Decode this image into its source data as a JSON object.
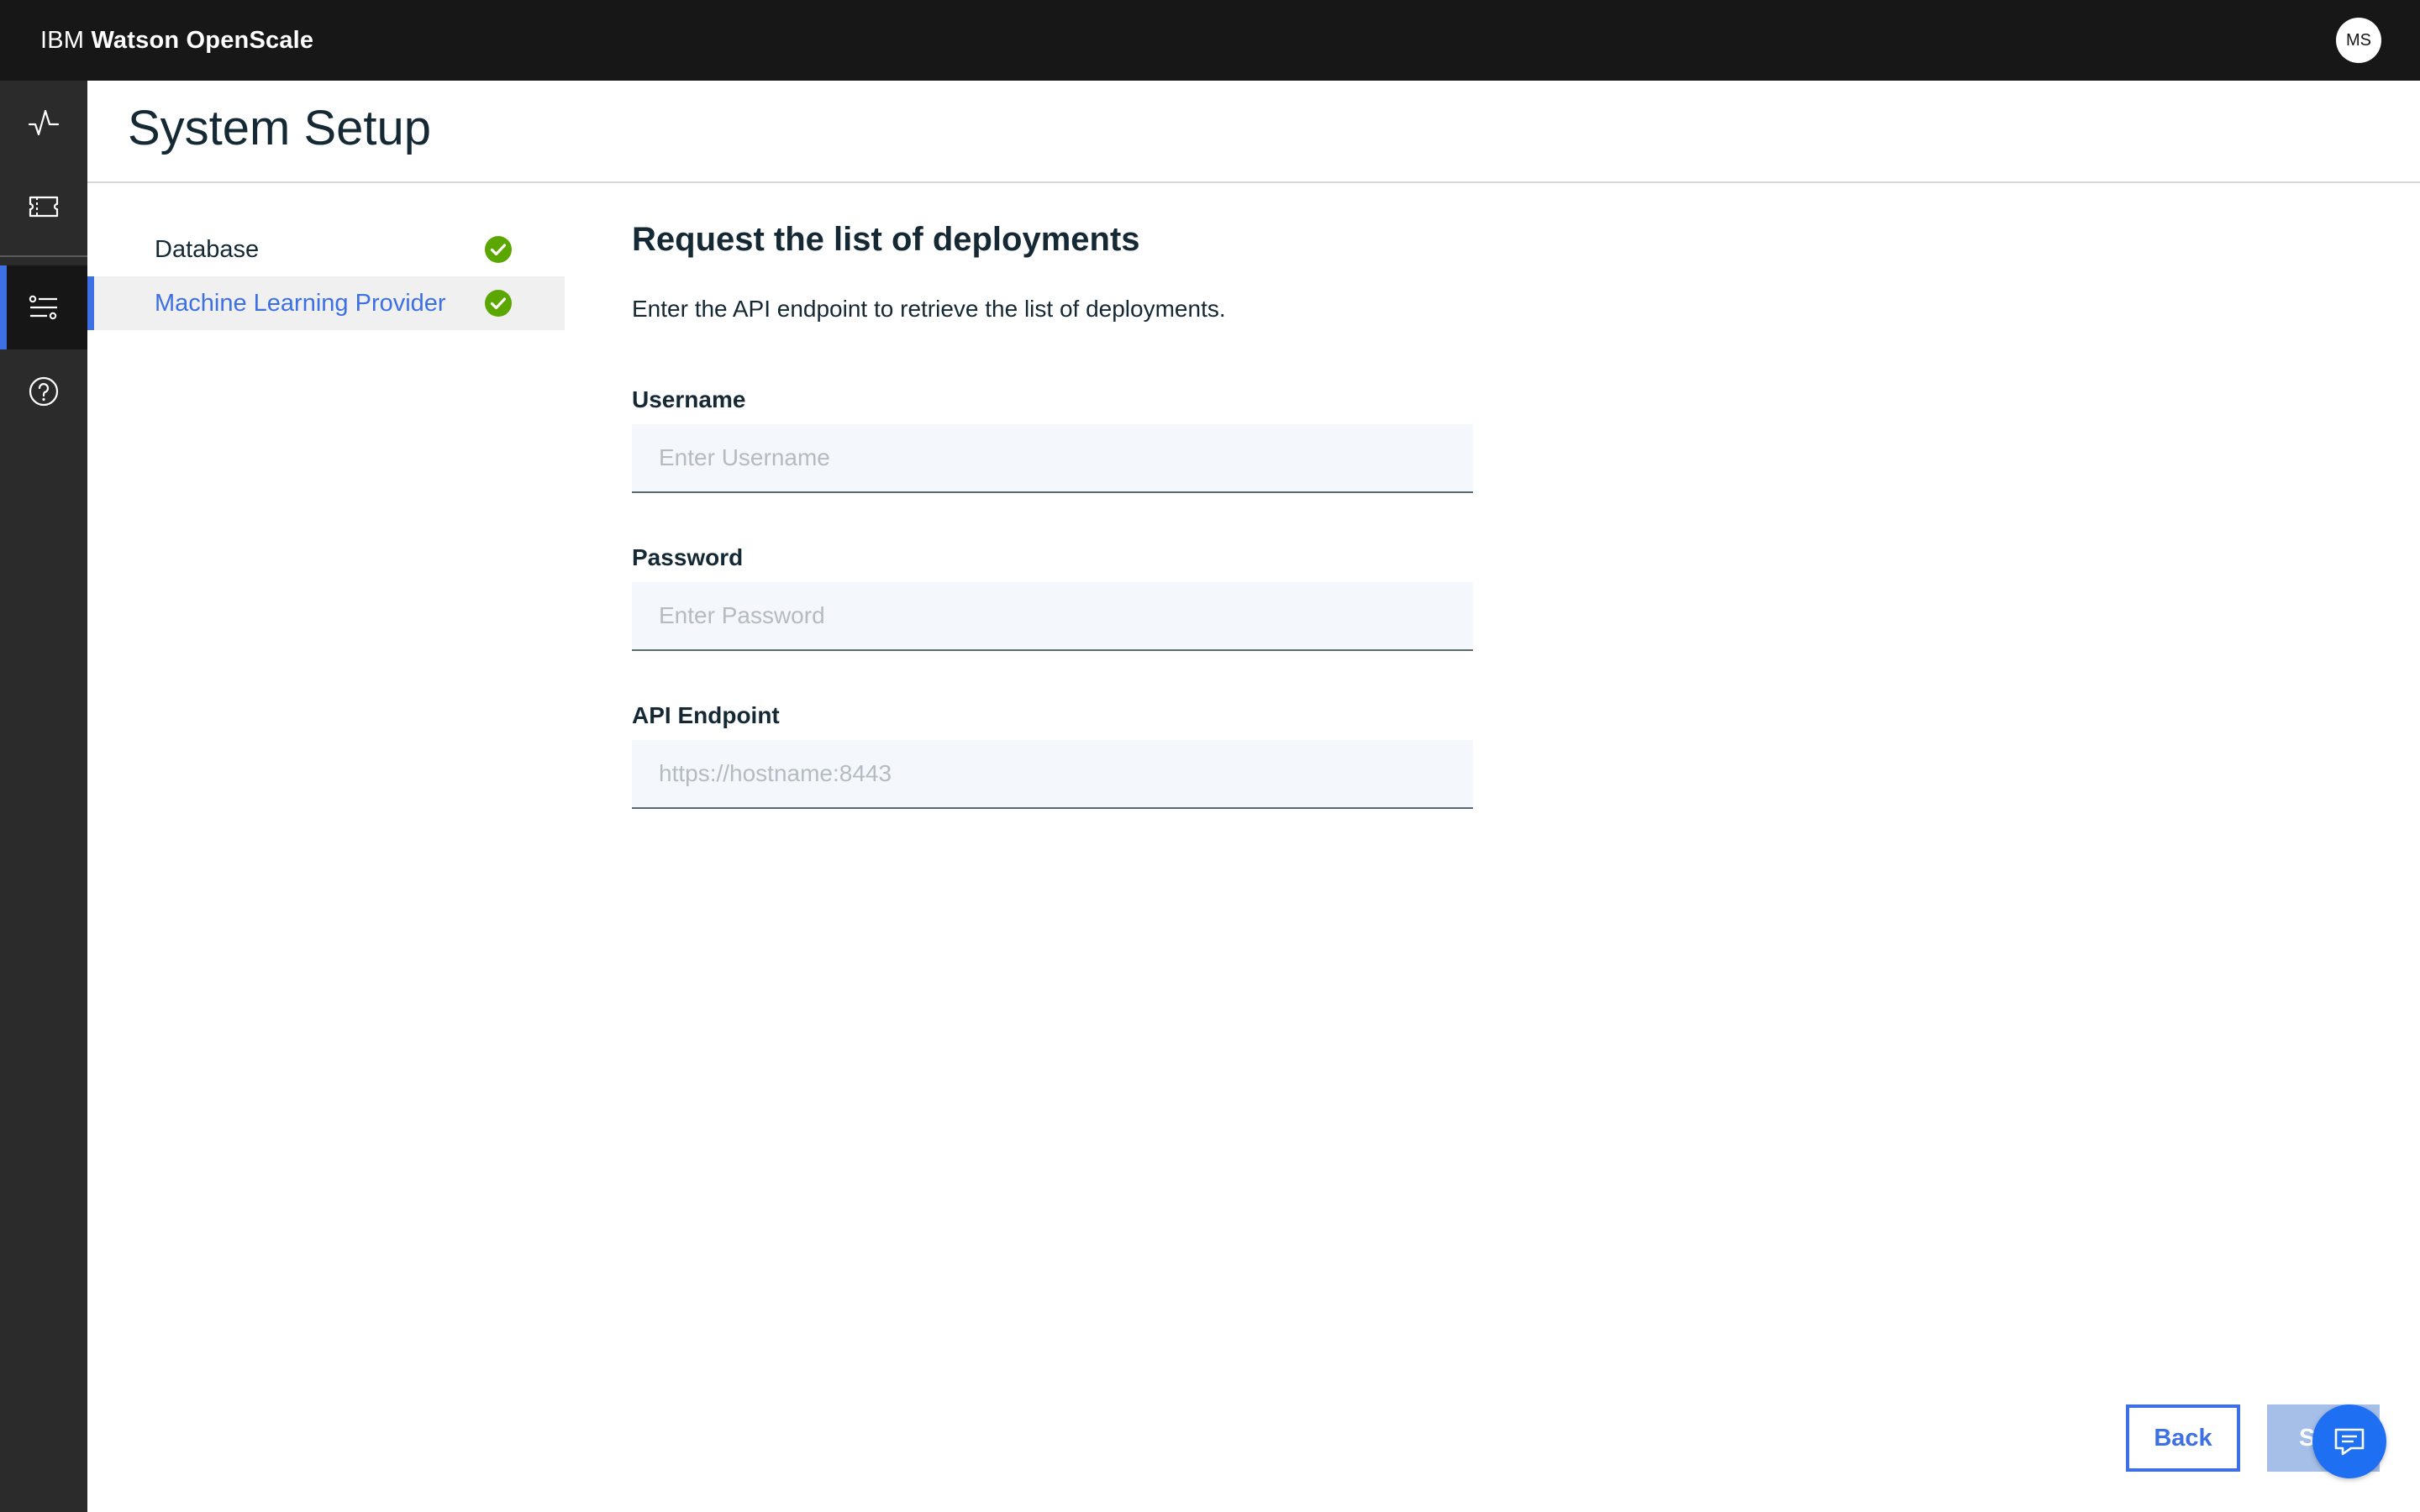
{
  "app": {
    "brand_prefix": "IBM",
    "brand_name": "Watson OpenScale",
    "user_initials": "MS"
  },
  "rail": {
    "items": [
      {
        "icon": "activity-icon"
      },
      {
        "icon": "ticket-icon"
      },
      {
        "icon": "settings-sliders-icon",
        "active": true
      },
      {
        "icon": "help-icon"
      }
    ]
  },
  "page": {
    "title": "System Setup"
  },
  "steps": [
    {
      "label": "Database",
      "complete": true,
      "active": false
    },
    {
      "label": "Machine Learning Provider",
      "complete": true,
      "active": true
    }
  ],
  "form": {
    "heading": "Request the list of deployments",
    "description": "Enter the API endpoint to retrieve the list of deployments.",
    "fields": [
      {
        "label": "Username",
        "value": "",
        "placeholder": "Enter Username"
      },
      {
        "label": "Password",
        "value": "",
        "placeholder": "Enter Password"
      },
      {
        "label": "API Endpoint",
        "value": "",
        "placeholder": "https://hostname:8443"
      }
    ]
  },
  "actions": {
    "back_label": "Back",
    "save_label_visible": "S"
  },
  "colors": {
    "accent": "#3d70e5",
    "success": "#5aa700",
    "topbar": "#171717",
    "rail": "#2b2b2b"
  }
}
